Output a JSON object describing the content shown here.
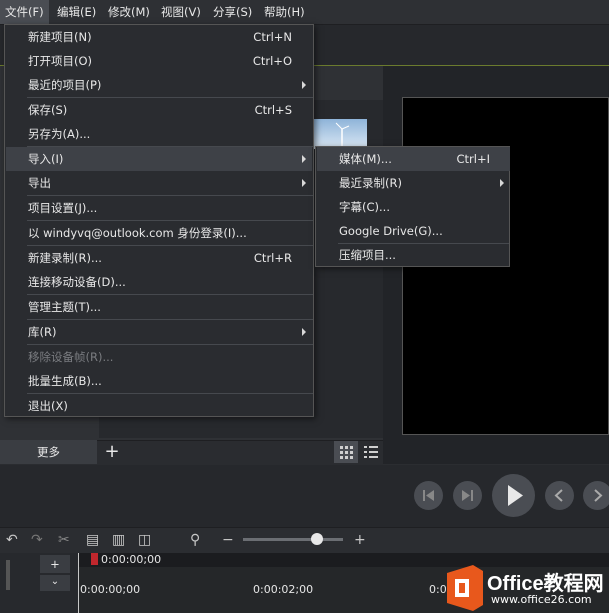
{
  "menubar": [
    "文件(F)",
    "编辑(E)",
    "修改(M)",
    "视图(V)",
    "分享(S)",
    "帮助(H)"
  ],
  "file_menu": [
    {
      "label": "新建项目(N)",
      "shortcut": "Ctrl+N"
    },
    {
      "label": "打开项目(O)",
      "shortcut": "Ctrl+O"
    },
    {
      "label": "最近的项目(P)",
      "shortcut": ""
    },
    {
      "label": "保存(S)",
      "shortcut": "Ctrl+S"
    },
    {
      "label": "另存为(A)...",
      "shortcut": ""
    },
    {
      "label": "导入(I)",
      "shortcut": ""
    },
    {
      "label": "导出",
      "shortcut": ""
    },
    {
      "label": "项目设置(J)...",
      "shortcut": ""
    },
    {
      "label": "以 windyvq@outlook.com 身份登录(I)...",
      "shortcut": ""
    },
    {
      "label": "新建录制(R)...",
      "shortcut": "Ctrl+R"
    },
    {
      "label": "连接移动设备(D)...",
      "shortcut": ""
    },
    {
      "label": "管理主题(T)...",
      "shortcut": ""
    },
    {
      "label": "库(R)",
      "shortcut": ""
    },
    {
      "label": "移除设备帧(R)...",
      "shortcut": ""
    },
    {
      "label": "批量生成(B)...",
      "shortcut": ""
    },
    {
      "label": "退出(X)",
      "shortcut": ""
    }
  ],
  "import_submenu": [
    {
      "label": "媒体(M)...",
      "shortcut": "Ctrl+I"
    },
    {
      "label": "最近录制(R)",
      "shortcut": ""
    },
    {
      "label": "字幕(C)...",
      "shortcut": ""
    },
    {
      "label": "Google Drive(G)...",
      "shortcut": ""
    },
    {
      "label": "压缩项目...",
      "shortcut": ""
    }
  ],
  "media_panel": {
    "more_label": "更多",
    "add_label": "+"
  },
  "timeline": {
    "playhead_time": "0:00:00;00",
    "ruler_start": "0:00:00;00",
    "ruler_mid": "0:00:02;00",
    "ruler_end": "0:0"
  },
  "watermark": {
    "brand": "Office教程网",
    "url": "www.office26.com"
  }
}
